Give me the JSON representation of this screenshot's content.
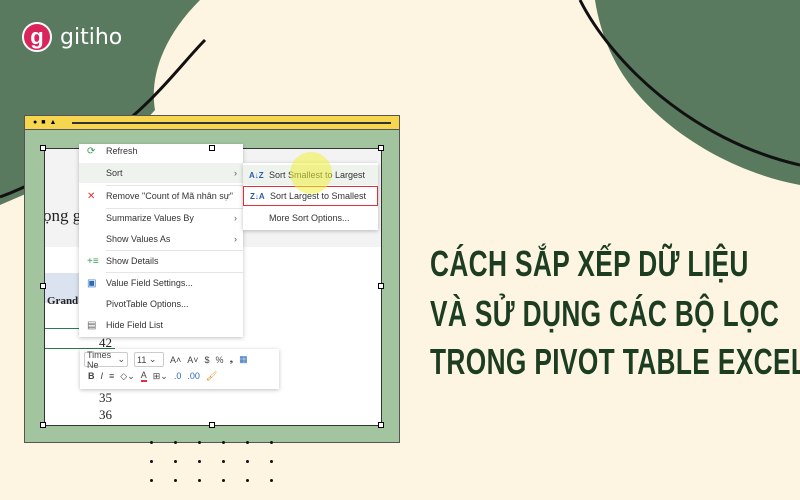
{
  "brand": {
    "logo_letter": "g",
    "name": "gitiho"
  },
  "headline": [
    "CÁCH SẮP XẾP DỮ LIỆU",
    "VÀ SỬ DỤNG CÁC BỘ LỌC",
    "TRONG PIVOT TABLE EXCEL"
  ],
  "sheet": {
    "partial_heading": "ọng g",
    "grand_label": "Grand",
    "values": [
      "42",
      "35",
      "36"
    ]
  },
  "context_menu": {
    "items": [
      {
        "label": "Refresh",
        "icon": "refresh-icon"
      },
      {
        "label": "Sort",
        "icon": "",
        "submenu": true
      },
      {
        "label": "Remove \"Count of Mã nhân sự\"",
        "icon": "remove-icon"
      },
      {
        "label": "Summarize Values By",
        "icon": "",
        "submenu": true
      },
      {
        "label": "Show Values As",
        "icon": "",
        "submenu": true
      },
      {
        "label": "Show Details",
        "icon": "show-details-icon"
      },
      {
        "label": "Value Field Settings...",
        "icon": "field-settings-icon"
      },
      {
        "label": "PivotTable Options...",
        "icon": ""
      },
      {
        "label": "Hide Field List",
        "icon": "field-list-icon"
      }
    ]
  },
  "sort_submenu": {
    "items": [
      {
        "label": "Sort Smallest to Largest",
        "icon": "sort-ascending-icon"
      },
      {
        "label": "Sort Largest to Smallest",
        "icon": "sort-descending-icon",
        "highlighted": true
      },
      {
        "label": "More Sort Options...",
        "icon": ""
      }
    ]
  },
  "mini_toolbar": {
    "font": "Times Ne",
    "size": "11",
    "bold": "B",
    "italic": "I",
    "currency": "$",
    "percent": "%",
    "comma": "❟"
  },
  "colors": {
    "green": "#5a7a5f",
    "cream": "#fdf5e1",
    "accent_red": "#e0313a",
    "brand": "#d9245c",
    "title": "#1d3d22"
  }
}
